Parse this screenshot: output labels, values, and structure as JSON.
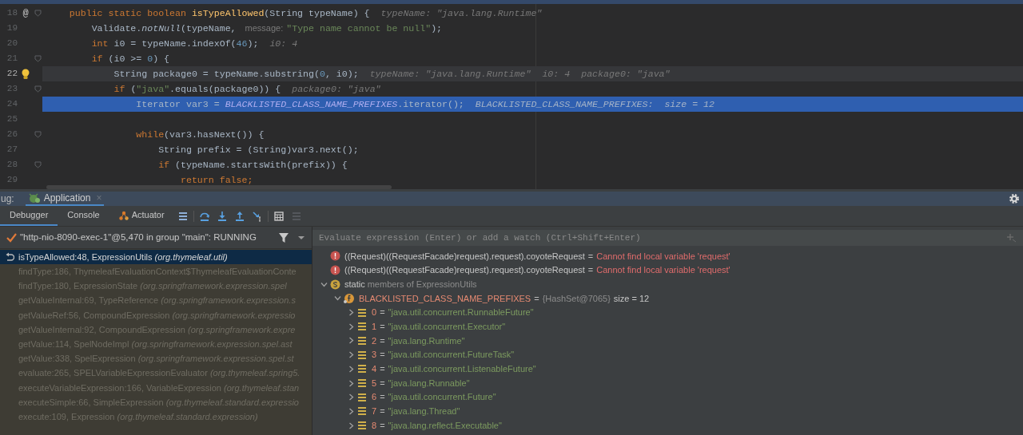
{
  "editor": {
    "lines": [
      {
        "number": "18",
        "marker": "@",
        "fold": true,
        "caret": false,
        "selected": false,
        "segments": [
          {
            "kind": "kw",
            "text": "    public static boolean "
          },
          {
            "kind": "decl",
            "text": "isTypeAllowed"
          },
          {
            "kind": "plain",
            "text": "(String typeName) {"
          },
          {
            "kind": "hint",
            "text": "typeName: \"java.lang.Runtime\""
          }
        ]
      },
      {
        "number": "19",
        "fold": false,
        "caret": false,
        "selected": false,
        "segments": [
          {
            "kind": "plain",
            "text": "        Validate."
          },
          {
            "kind": "ital",
            "text": "notNull"
          },
          {
            "kind": "plain",
            "text": "(typeName, "
          },
          {
            "kind": "param",
            "text": "message:"
          },
          {
            "kind": "str",
            "text": "\"Type name cannot be null\""
          },
          {
            "kind": "plain",
            "text": ");"
          }
        ]
      },
      {
        "number": "20",
        "fold": false,
        "caret": false,
        "selected": false,
        "segments": [
          {
            "kind": "kw",
            "text": "        int "
          },
          {
            "kind": "plain",
            "text": "i0 = typeName.indexOf("
          },
          {
            "kind": "num",
            "text": "46"
          },
          {
            "kind": "plain",
            "text": ");"
          },
          {
            "kind": "hint",
            "text": "i0: 4"
          }
        ]
      },
      {
        "number": "21",
        "fold": true,
        "caret": false,
        "selected": false,
        "segments": [
          {
            "kind": "kw",
            "text": "        if "
          },
          {
            "kind": "plain",
            "text": "(i0 >= "
          },
          {
            "kind": "num",
            "text": "0"
          },
          {
            "kind": "plain",
            "text": ") {"
          }
        ]
      },
      {
        "number": "22",
        "bulb": true,
        "fold": false,
        "caret": true,
        "selected": false,
        "segments": [
          {
            "kind": "plain",
            "text": "            String package0 = typeName.substring("
          },
          {
            "kind": "num",
            "text": "0"
          },
          {
            "kind": "plain",
            "text": ", i0);"
          },
          {
            "kind": "hint",
            "text": "typeName: \"java.lang.Runtime\""
          },
          {
            "kind": "hint",
            "text": "i0: 4"
          },
          {
            "kind": "hint",
            "text": "package0: \"java\""
          }
        ]
      },
      {
        "number": "23",
        "fold": true,
        "caret": false,
        "selected": false,
        "segments": [
          {
            "kind": "kw",
            "text": "            if "
          },
          {
            "kind": "plain",
            "text": "("
          },
          {
            "kind": "str",
            "text": "\"java\""
          },
          {
            "kind": "plain",
            "text": ".equals(package0)) {"
          },
          {
            "kind": "hint",
            "text": "package0: \"java\""
          }
        ]
      },
      {
        "number": "24",
        "fold": false,
        "caret": false,
        "selected": true,
        "segments": [
          {
            "kind": "plain",
            "text": "                Iterator var3 = "
          },
          {
            "kind": "field",
            "text": "BLACKLISTED_CLASS_NAME_PREFIXES"
          },
          {
            "kind": "plain",
            "text": ".iterator();"
          },
          {
            "kind": "hint",
            "text": "BLACKLISTED_CLASS_NAME_PREFIXES:  size = 12"
          }
        ]
      },
      {
        "number": "25",
        "fold": false,
        "caret": false,
        "selected": false
      },
      {
        "number": "26",
        "fold": true,
        "caret": false,
        "selected": false,
        "segments": [
          {
            "kind": "kw",
            "text": "                while"
          },
          {
            "kind": "plain",
            "text": "(var3.hasNext()) {"
          }
        ]
      },
      {
        "number": "27",
        "fold": false,
        "caret": false,
        "selected": false,
        "segments": [
          {
            "kind": "plain",
            "text": "                    String prefix = (String)var3.next();"
          }
        ]
      },
      {
        "number": "28",
        "fold": true,
        "caret": false,
        "selected": false,
        "segments": [
          {
            "kind": "kw",
            "text": "                    if "
          },
          {
            "kind": "plain",
            "text": "(typeName.startsWith(prefix)) {"
          }
        ]
      },
      {
        "number": "29",
        "fold": false,
        "caret": false,
        "selected": false,
        "segments": [
          {
            "kind": "kw",
            "text": "                        return false;"
          }
        ]
      }
    ]
  },
  "debug": {
    "title": "ug:",
    "session_tab": {
      "label": "Application",
      "close": "×"
    },
    "tabs": [
      {
        "label": "Debugger",
        "selected": true
      },
      {
        "label": "Console",
        "selected": false
      },
      {
        "label": "Actuator",
        "selected": false,
        "icon": true
      }
    ],
    "thread": "\"http-nio-8090-exec-1\"@5,470 in group \"main\": RUNNING",
    "frames": [
      {
        "method": "isTypeAllowed:48, ExpressionUtils",
        "package": "(org.thymeleaf.util)",
        "selected": true
      },
      {
        "method": "findType:186, ThymeleafEvaluationContext$ThymeleafEvaluationConte",
        "selected": false
      },
      {
        "method": "findType:180, ExpressionState",
        "package": "(org.springframework.expression.spel",
        "selected": false
      },
      {
        "method": "getValueInternal:69, TypeReference",
        "package": "(org.springframework.expression.s",
        "selected": false
      },
      {
        "method": "getValueRef:56, CompoundExpression",
        "package": "(org.springframework.expressio",
        "selected": false
      },
      {
        "method": "getValueInternal:92, CompoundExpression",
        "package": "(org.springframework.expre",
        "selected": false
      },
      {
        "method": "getValue:114, SpelNodeImpl",
        "package": "(org.springframework.expression.spel.ast",
        "selected": false
      },
      {
        "method": "getValue:338, SpelExpression",
        "package": "(org.springframework.expression.spel.st",
        "selected": false
      },
      {
        "method": "evaluate:265, SPELVariableExpressionEvaluator",
        "package": "(org.thymeleaf.spring5.",
        "selected": false
      },
      {
        "method": "executeVariableExpression:166, VariableExpression",
        "package": "(org.thymeleaf.stan",
        "selected": false
      },
      {
        "method": "executeSimple:66, SimpleExpression",
        "package": "(org.thymeleaf.standard.expressio",
        "selected": false
      },
      {
        "method": "execute:109, Expression",
        "package": "(org.thymeleaf.standard.expression)",
        "selected": false
      }
    ],
    "evaluate": {
      "placeholder": "Evaluate expression (Enter) or add a watch (Ctrl+Shift+Enter)"
    },
    "variables": [
      {
        "kind": "watch",
        "expression": "((Request)((RequestFacade)request).request).coyoteRequest",
        "separator": "=",
        "value": "Cannot find local variable 'request'"
      },
      {
        "kind": "watch",
        "expression": "((Request)((RequestFacade)request).request).coyoteRequest",
        "separator": "=",
        "value": "Cannot find local variable 'request'"
      },
      {
        "kind": "static",
        "keyword": "static",
        "text": "members of ExpressionUtils",
        "expanded": true,
        "children": [
          {
            "kind": "field",
            "name": "BLACKLISTED_CLASS_NAME_PREFIXES",
            "separator": "=",
            "type": "{HashSet@7065}",
            "size": "size = 12",
            "expanded": true,
            "children": [
              {
                "kind": "element",
                "index": "0",
                "separator": "=",
                "value": "\"java.util.concurrent.RunnableFuture\"",
                "expanded": false
              },
              {
                "kind": "element",
                "index": "1",
                "separator": "=",
                "value": "\"java.util.concurrent.Executor\"",
                "expanded": false
              },
              {
                "kind": "element",
                "index": "2",
                "separator": "=",
                "value": "\"java.lang.Runtime\"",
                "expanded": false
              },
              {
                "kind": "element",
                "index": "3",
                "separator": "=",
                "value": "\"java.util.concurrent.FutureTask\"",
                "expanded": false
              },
              {
                "kind": "element",
                "index": "4",
                "separator": "=",
                "value": "\"java.util.concurrent.ListenableFuture\"",
                "expanded": false
              },
              {
                "kind": "element",
                "index": "5",
                "separator": "=",
                "value": "\"java.lang.Runnable\"",
                "expanded": false
              },
              {
                "kind": "element",
                "index": "6",
                "separator": "=",
                "value": "\"java.util.concurrent.Future\"",
                "expanded": false
              },
              {
                "kind": "element",
                "index": "7",
                "separator": "=",
                "value": "\"java.lang.Thread\"",
                "expanded": false
              },
              {
                "kind": "element",
                "index": "8",
                "separator": "=",
                "value": "\"java.lang.reflect.Executable\"",
                "expanded": false
              }
            ]
          }
        ]
      }
    ]
  }
}
